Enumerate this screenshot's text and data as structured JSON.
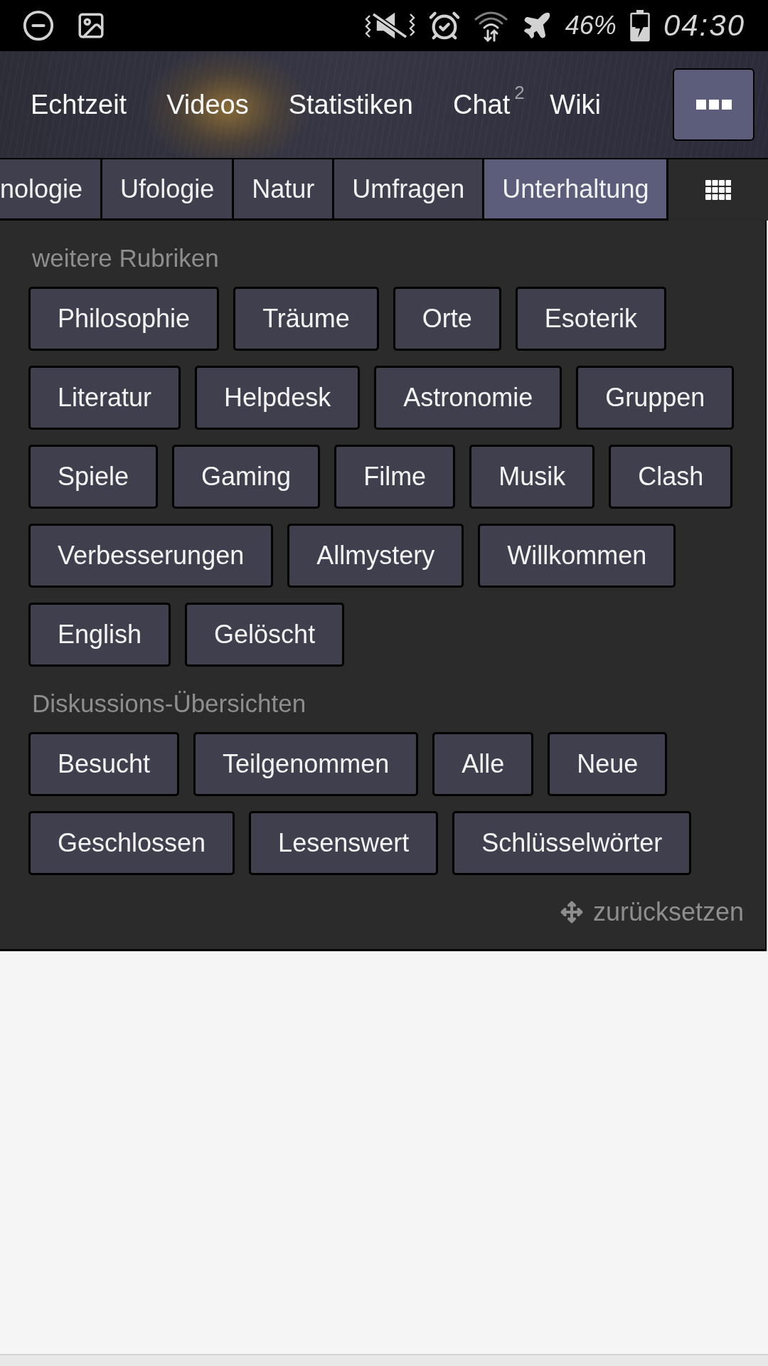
{
  "status_bar": {
    "battery": "46%",
    "time": "04:30"
  },
  "nav": {
    "items": [
      {
        "label": "Echtzeit"
      },
      {
        "label": "Videos"
      },
      {
        "label": "Statistiken"
      },
      {
        "label": "Chat",
        "badge": "2"
      },
      {
        "label": "Wiki"
      }
    ]
  },
  "tabs": [
    {
      "label": "nologie",
      "selected": false
    },
    {
      "label": "Ufologie",
      "selected": false
    },
    {
      "label": "Natur",
      "selected": false
    },
    {
      "label": "Umfragen",
      "selected": false
    },
    {
      "label": "Unterhaltung",
      "selected": true
    }
  ],
  "sections": [
    {
      "title": "weitere Rubriken",
      "buttons": [
        "Philosophie",
        "Träume",
        "Orte",
        "Esoterik",
        "Literatur",
        "Helpdesk",
        "Astronomie",
        "Gruppen",
        "Spiele",
        "Gaming",
        "Filme",
        "Musik",
        "Clash",
        "Verbesserungen",
        "Allmystery",
        "Willkommen",
        "English",
        "Gelöscht"
      ]
    },
    {
      "title": "Diskussions-Übersichten",
      "buttons": [
        "Besucht",
        "Teilgenommen",
        "Alle",
        "Neue",
        "Geschlossen",
        "Lesenswert",
        "Schlüsselwörter"
      ]
    }
  ],
  "reset_link": {
    "label": "zurücksetzen"
  }
}
